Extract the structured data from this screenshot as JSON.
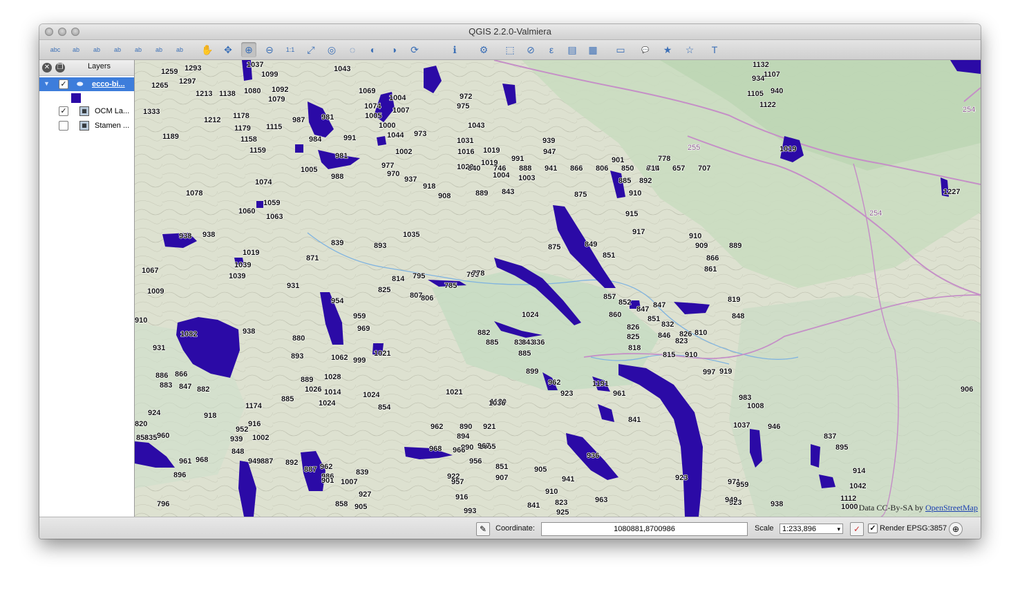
{
  "window": {
    "title": "QGIS 2.2.0-Valmiera"
  },
  "toolbar": {
    "buttons": [
      {
        "name": "label-tool-icon",
        "glyph": "abc"
      },
      {
        "name": "label-pin-icon",
        "glyph": "ab"
      },
      {
        "name": "label-highlight-icon",
        "glyph": "ab"
      },
      {
        "name": "label-move-icon",
        "glyph": "ab"
      },
      {
        "name": "label-rotate-icon",
        "glyph": "ab"
      },
      {
        "name": "label-change-icon",
        "glyph": "ab"
      },
      {
        "name": "label-show-icon",
        "glyph": "ab"
      },
      {
        "name": "pan-icon",
        "glyph": "✋"
      },
      {
        "name": "pan-selection-icon",
        "glyph": "✥"
      },
      {
        "name": "zoom-in-icon",
        "glyph": "⊕"
      },
      {
        "name": "zoom-out-icon",
        "glyph": "⊖"
      },
      {
        "name": "zoom-native-icon",
        "glyph": "1:1"
      },
      {
        "name": "zoom-full-icon",
        "glyph": "⤢"
      },
      {
        "name": "zoom-selection-icon",
        "glyph": "◎"
      },
      {
        "name": "zoom-layer-icon",
        "glyph": "◌"
      },
      {
        "name": "zoom-last-icon",
        "glyph": "◐"
      },
      {
        "name": "zoom-next-icon",
        "glyph": "◑"
      },
      {
        "name": "refresh-icon",
        "glyph": "⟳"
      },
      {
        "name": "identify-icon",
        "glyph": "ℹ"
      },
      {
        "name": "action-icon",
        "glyph": "⚙"
      },
      {
        "name": "select-icon",
        "glyph": "⬚"
      },
      {
        "name": "deselect-icon",
        "glyph": "⊘"
      },
      {
        "name": "expression-select-icon",
        "glyph": "ε"
      },
      {
        "name": "attribute-table-icon",
        "glyph": "▤"
      },
      {
        "name": "field-calculator-icon",
        "glyph": "▦"
      },
      {
        "name": "measure-icon",
        "glyph": "▭"
      },
      {
        "name": "map-tips-icon",
        "glyph": "💬"
      },
      {
        "name": "new-bookmark-icon",
        "glyph": "★"
      },
      {
        "name": "show-bookmarks-icon",
        "glyph": "☆"
      },
      {
        "name": "text-annotation-icon",
        "glyph": "T"
      }
    ]
  },
  "layers": {
    "title": "Layers",
    "items": [
      {
        "label": "ecco-bi...",
        "checked": "✓"
      },
      {
        "label": "OCM La...",
        "checked": "✓"
      },
      {
        "label": "Stamen ...",
        "checked": ""
      }
    ],
    "swatch_color": "#2b0aa6"
  },
  "map": {
    "attribution_prefix": "Data CC-By-SA by ",
    "attribution_link": "OpenStreetMap",
    "road_numbers": [
      "255",
      "254",
      "254"
    ],
    "labels": [
      "1259",
      "1293",
      "1037",
      "1099",
      "1043",
      "1265",
      "1297",
      "1213",
      "1138",
      "1080",
      "1092",
      "1079",
      "1069",
      "1004",
      "972",
      "975",
      "1074",
      "1007",
      "1005",
      "1333",
      "1178",
      "1212",
      "1179",
      "1115",
      "987",
      "981",
      "1000",
      "1043",
      "1158",
      "1159",
      "1044",
      "973",
      "1031",
      "991",
      "984",
      "1189",
      "1002",
      "1016",
      "1019",
      "939",
      "947",
      "981",
      "1005",
      "988",
      "977",
      "970",
      "1020",
      "1019",
      "991",
      "937",
      "1004",
      "1003",
      "918",
      "908",
      "889",
      "843",
      "1074",
      "1078",
      "1059",
      "1060",
      "1063",
      "901",
      "778",
      "836",
      "885",
      "892",
      "910",
      "875",
      "915",
      "917",
      "910",
      "909",
      "889",
      "938",
      "938",
      "1035",
      "839",
      "893",
      "875",
      "849",
      "851",
      "866",
      "861",
      "871",
      "1019",
      "1039",
      "1039",
      "1067",
      "814",
      "795",
      "793",
      "778",
      "825",
      "807",
      "806",
      "931",
      "785",
      "1009",
      "954",
      "959",
      "969",
      "857",
      "852",
      "847",
      "847",
      "819",
      "851",
      "860",
      "848",
      "1024",
      "826",
      "832",
      "846",
      "826",
      "825",
      "823",
      "810",
      "818",
      "815",
      "910",
      "938",
      "910",
      "1082",
      "880",
      "882",
      "885",
      "836",
      "836",
      "843",
      "885",
      "893",
      "1062",
      "999",
      "1021",
      "997",
      "919",
      "931",
      "899",
      "962",
      "886",
      "866",
      "883",
      "847",
      "882",
      "889",
      "1028",
      "1026",
      "1014",
      "1021",
      "1191",
      "923",
      "885",
      "1024",
      "1024",
      "1174",
      "854",
      "1120",
      "961",
      "924",
      "918",
      "983",
      "1008",
      "820",
      "916",
      "1036",
      "854",
      "962",
      "952",
      "946",
      "890",
      "921",
      "841",
      "1037",
      "960",
      "939",
      "1002",
      "894",
      "990",
      "1055",
      "837",
      "848",
      "968",
      "966",
      "967",
      "895",
      "835",
      "961",
      "968",
      "949",
      "887",
      "892",
      "887",
      "962",
      "956",
      "851",
      "907",
      "905",
      "914",
      "896",
      "986",
      "839",
      "922",
      "957",
      "941",
      "936",
      "1042",
      "901",
      "1007",
      "927",
      "923",
      "971",
      "959",
      "1112",
      "796",
      "858",
      "905",
      "916",
      "910",
      "923",
      "823",
      "963",
      "949",
      "841",
      "993",
      "925",
      "938",
      "1000",
      "1107",
      "934",
      "1132",
      "1105",
      "940",
      "1122",
      "1019",
      "1227",
      "906",
      "840",
      "746",
      "888",
      "941",
      "866",
      "806",
      "850",
      "714",
      "657",
      "707"
    ]
  },
  "status": {
    "coordinate_label": "Coordinate:",
    "coordinate_value": "1080881,8700986",
    "scale_label": "Scale",
    "scale_value": "1:233,896",
    "render_label": "Render",
    "render_checked": "✓",
    "crs": "EPSG:3857"
  },
  "colors": {
    "water": "#2b0aa6",
    "selection": "#3d7ddb",
    "road": "#c58fc7"
  }
}
